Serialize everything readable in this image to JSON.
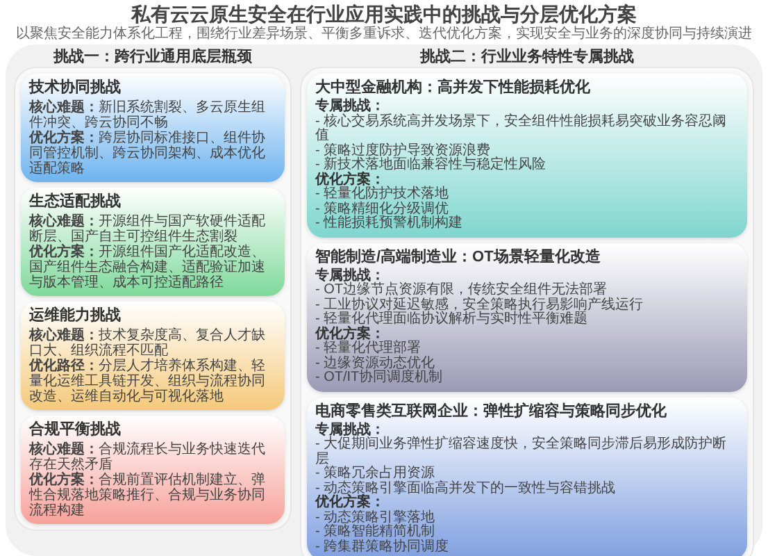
{
  "title": "私有云云原生安全在行业应用实践中的挑战与分层优化方案",
  "subtitle": "以聚焦安全能力体系化工程，围绕行业差异场景、平衡多重诉求、迭代优化方案，实现安全与业务的深度协同与持续演进",
  "columns": [
    {
      "heading": "挑战一：跨行业通用底层瓶颈",
      "cards": [
        {
          "title": "技术协同挑战",
          "color": "#6db3ef",
          "lines": [
            "**核心难题：**新旧系统割裂、多云原生组件冲突、跨云协同不畅",
            "**优化方案：**跨层协同标准接口、组件协同管控机制、跨云协同架构、成本优化适配策略"
          ]
        },
        {
          "title": "生态适配挑战",
          "color": "#7ed99a",
          "lines": [
            "**核心难题：**开源组件与国产软硬件适配断层、国产自主可控组件生态割裂",
            "**优化方案：**开源组件国产化适配改造、国产组件生态融合构建、适配验证加速与版本管理、成本可控适配路径"
          ]
        },
        {
          "title": "运维能力挑战",
          "color": "#f5c97a",
          "lines": [
            "**核心难题：**技术复杂度高、复合人才缺口大、组织流程不匹配",
            "**优化路径：**分层人才培养体系构建、轻量化运维工具链开发、组织与流程协同改造、运维自动化与可视化落地"
          ]
        },
        {
          "title": "合规平衡挑战",
          "color": "#f7a19a",
          "lines": [
            "**核心难题：**合规流程长与业务快速迭代存在天然矛盾",
            "**优化方案：**合规前置评估机制建立、弹性合规落地策略推行、合规与业务协同流程构建"
          ]
        }
      ]
    },
    {
      "heading": "挑战二：行业业务特性专属挑战",
      "cards": [
        {
          "title": "大中型金融机构：高并发下性能损耗优化",
          "color": "#7fd6cf",
          "sections": [
            {
              "heading": "专属挑战：",
              "items": [
                "- 核心交易系统高并发场景下，安全组件性能损耗易突破业务容忍阈值",
                "- 策略过度防护导致资源浪费",
                "- 新技术落地面临兼容性与稳定性风险"
              ]
            },
            {
              "heading": "优化方案：",
              "items": [
                "- 轻量化防护技术落地",
                "- 策略精细化分级调优",
                "- 性能损耗预警机制构建"
              ]
            }
          ]
        },
        {
          "title": "智能制造/高端制造业：OT场景轻量化改造",
          "color": "#9a9ab6",
          "sections": [
            {
              "heading": "专属挑战：",
              "items": [
                "- OT边缘节点资源有限，传统安全组件无法部署",
                "- 工业协议对延迟敏感，安全策略执行易影响产线运行",
                "- 轻量化代理面临协议解析与实时性平衡难题"
              ]
            },
            {
              "heading": "优化方案：",
              "items": [
                "- 轻量化代理部署",
                "- 边缘资源动态优化",
                "- OT/IT协同调度机制"
              ]
            }
          ]
        },
        {
          "title": "电商零售类互联网企业：弹性扩缩容与策略同步优化",
          "color": "#7f9fe0",
          "sections": [
            {
              "heading": "专属挑战：",
              "items": [
                "- 大促期间业务弹性扩缩容速度快，安全策略同步滞后易形成防护断层",
                "- 策略冗余占用资源",
                "- 动态策略引擎面临高并发下的一致性与容错挑战"
              ]
            },
            {
              "heading": "优化方案：",
              "items": [
                "- 动态策略引擎落地",
                "- 策略智能精简机制",
                "- 跨集群策略协同调度"
              ]
            }
          ]
        }
      ]
    }
  ]
}
